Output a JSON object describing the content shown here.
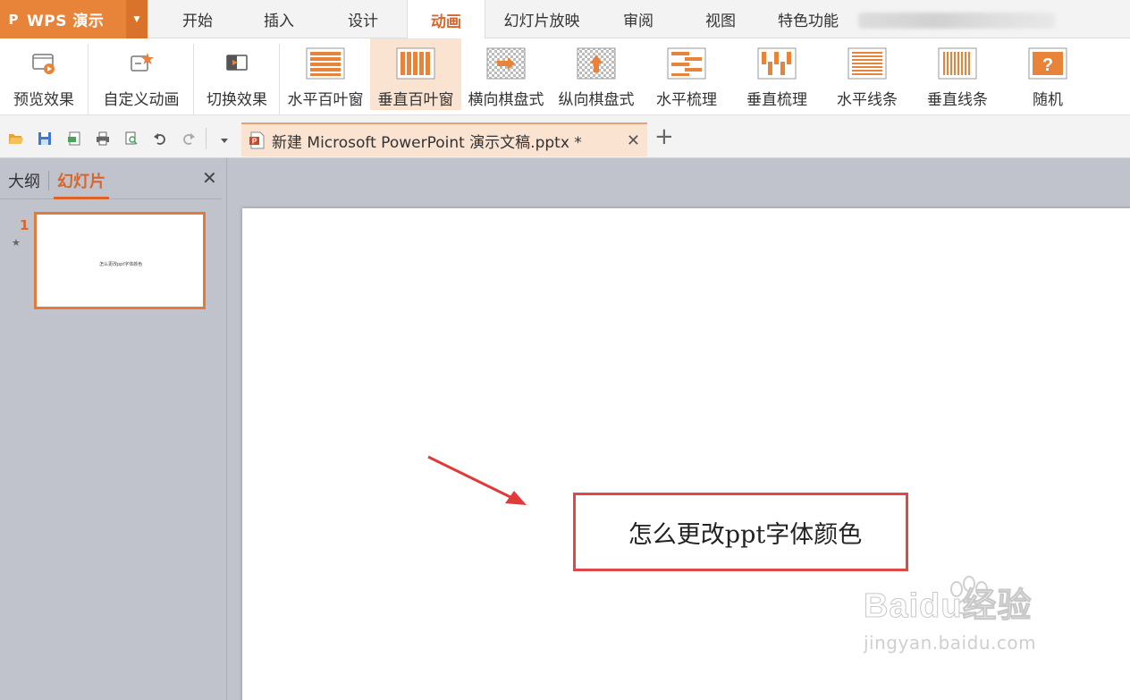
{
  "app": {
    "logo": "P",
    "name": "WPS 演示"
  },
  "menu": {
    "tabs": [
      {
        "label": "开始"
      },
      {
        "label": "插入"
      },
      {
        "label": "设计"
      },
      {
        "label": "动画"
      },
      {
        "label": "幻灯片放映"
      },
      {
        "label": "审阅"
      },
      {
        "label": "视图"
      },
      {
        "label": "特色功能"
      }
    ],
    "active": "动画"
  },
  "ribbon": {
    "preview": "预览效果",
    "custom_anim": "自定义动画",
    "transition": "切换效果",
    "gallery": [
      {
        "label": "水平百叶窗",
        "icon": "horizontal-blinds-icon"
      },
      {
        "label": "垂直百叶窗",
        "icon": "vertical-blinds-icon"
      },
      {
        "label": "横向棋盘式",
        "icon": "horizontal-checkerboard-icon"
      },
      {
        "label": "纵向棋盘式",
        "icon": "vertical-checkerboard-icon"
      },
      {
        "label": "水平梳理",
        "icon": "horizontal-comb-icon"
      },
      {
        "label": "垂直梳理",
        "icon": "vertical-comb-icon"
      },
      {
        "label": "水平线条",
        "icon": "horizontal-lines-icon"
      },
      {
        "label": "垂直线条",
        "icon": "vertical-lines-icon"
      },
      {
        "label": "随机",
        "icon": "random-icon"
      }
    ],
    "selected": "垂直百叶窗"
  },
  "doc_tab": {
    "title": "新建 Microsoft PowerPoint 演示文稿.pptx *"
  },
  "left_pane": {
    "tab_outline": "大纲",
    "tab_slides": "幻灯片",
    "slide_number": "1",
    "thumb_text": "怎么更改ppt字体颜色"
  },
  "slide": {
    "text": "怎么更改ppt字体颜色"
  },
  "watermark": {
    "main": "Baidu经验",
    "sub": "jingyan.baidu.com"
  },
  "colors": {
    "accent": "#e8833a",
    "active_tab_text": "#d9652b",
    "highlight": "#e04848"
  }
}
